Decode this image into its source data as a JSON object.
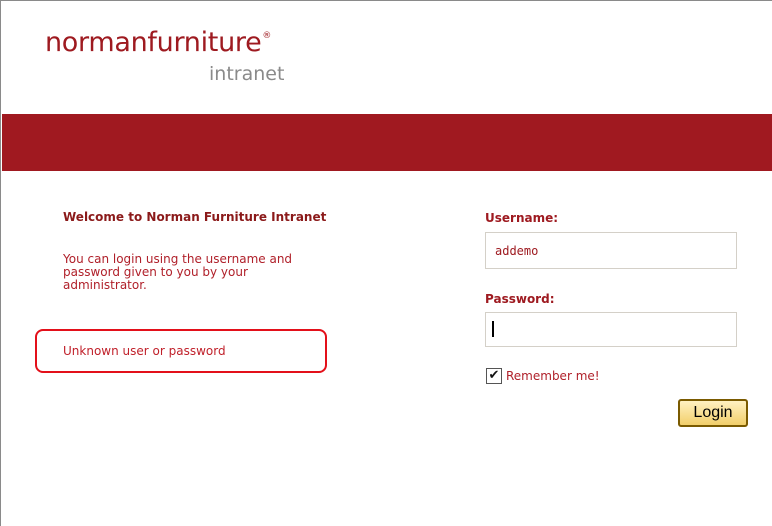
{
  "logo": {
    "brand_left": "norman",
    "brand_right": "furniture",
    "registered_mark": "®",
    "sub": "intranet"
  },
  "welcome": {
    "title": "Welcome to Norman Furniture Intranet",
    "intro_line1": "You can login using the username and",
    "intro_line2": "password given to you by your",
    "intro_line3": "administrator.",
    "error": "Unknown user or password"
  },
  "form": {
    "username_label": "Username:",
    "username_value": "addemo",
    "password_label": "Password:",
    "password_value": "",
    "remember_label": "Remember me!",
    "remember_checked": true,
    "login_label": "Login"
  },
  "colors": {
    "brand_red": "#a01920",
    "text_red": "#b0202a",
    "error_outline": "#e3101a",
    "muted_gray": "#8a8a8a"
  }
}
